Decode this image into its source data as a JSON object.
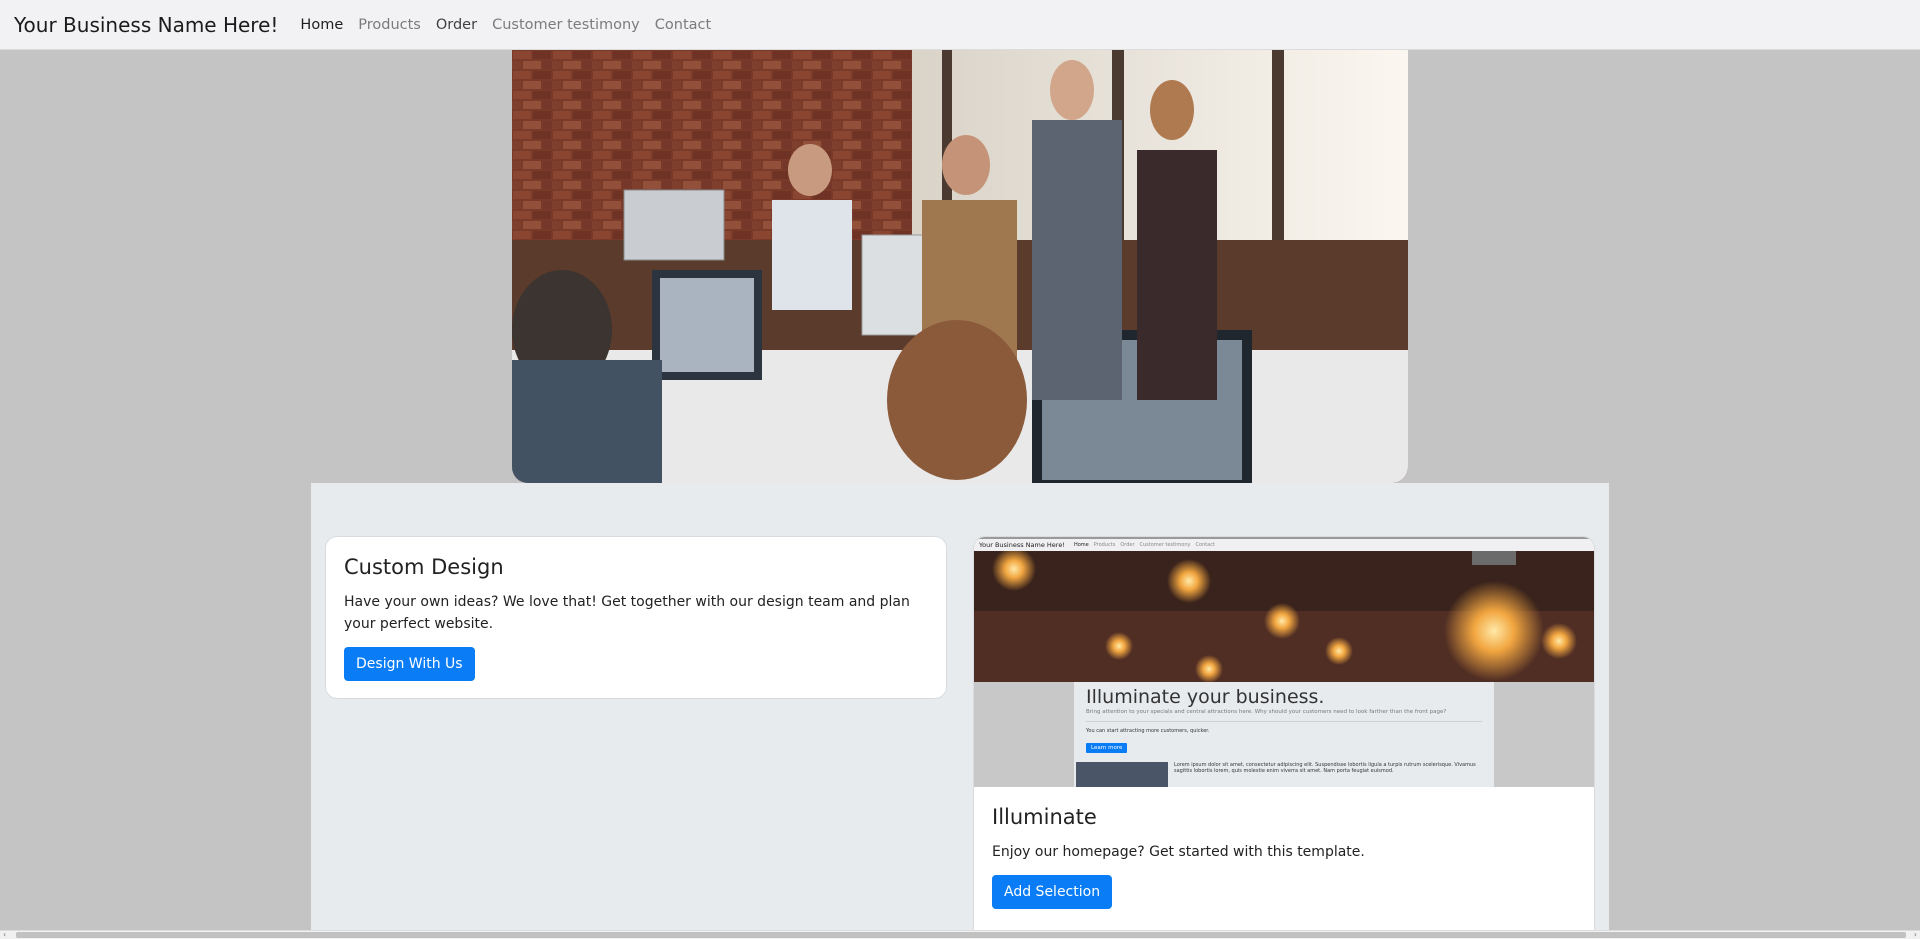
{
  "navbar": {
    "brand": "Your Business Name Here!",
    "links": [
      "Home",
      "Products",
      "Order",
      "Customer testimony",
      "Contact"
    ],
    "active": "Home"
  },
  "hero": {
    "icon": "office-team-photo"
  },
  "cards": {
    "custom": {
      "title": "Custom Design",
      "text": "Have your own ideas? We love that! Get together with our design team and plan your perfect website.",
      "button": "Design With Us"
    },
    "illuminate": {
      "title": "Illuminate",
      "text": "Enjoy our homepage? Get started with this template.",
      "button": "Add Selection",
      "preview": {
        "brand": "Your Business Name Here!",
        "links": [
          "Home",
          "Products",
          "Order",
          "Customer testimony",
          "Contact"
        ],
        "title": "Illuminate your business.",
        "subtitle": "Bring attention to your specials and central attractions here. Why should your customers need to look farther than the front page?",
        "small": "You can start attracting more customers, quicker.",
        "button": "Learn more",
        "body": "Lorem ipsum dolor sit amet, consectetur adipiscing elit. Suspendisse lobortis ligula a turpis rutrum scelerisque. Vivamus sagittis lobortis lorem, quis molestie enim viverra sit amet. Nam porta feugiat euismod."
      }
    }
  },
  "colors": {
    "primary": "#0a7cf5",
    "page_bg": "#c4c4c4",
    "content_bg": "#e8ebee"
  }
}
